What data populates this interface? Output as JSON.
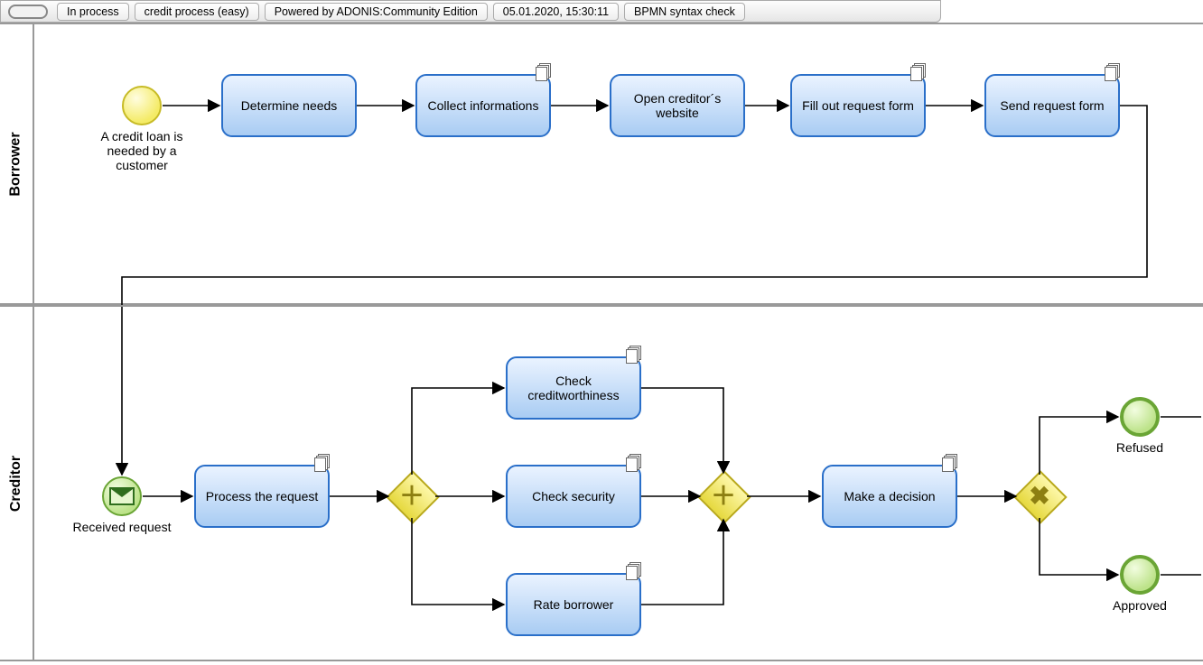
{
  "toolbar": {
    "status": "In process",
    "model_name": "credit process (easy)",
    "powered_by": "Powered by ADONIS:Community Edition",
    "timestamp": "05.01.2020, 15:30:11",
    "syntax": "BPMN syntax check"
  },
  "lanes": {
    "borrower": {
      "label": "Borrower"
    },
    "creditor": {
      "label": "Creditor"
    }
  },
  "borrower": {
    "start_label": "A credit loan is needed by a customer",
    "tasks": {
      "t1": "Determine needs",
      "t2": "Collect informations",
      "t3": "Open creditor´s website",
      "t4": "Fill out request form",
      "t5": "Send request form"
    }
  },
  "creditor": {
    "msg_event_label": "Received request",
    "tasks": {
      "p1": "Process the request",
      "c1": "Check creditworthiness",
      "c2": "Check security",
      "c3": "Rate borrower",
      "d1": "Make a decision"
    },
    "end_refused": "Refused",
    "end_approved": "Approved"
  }
}
